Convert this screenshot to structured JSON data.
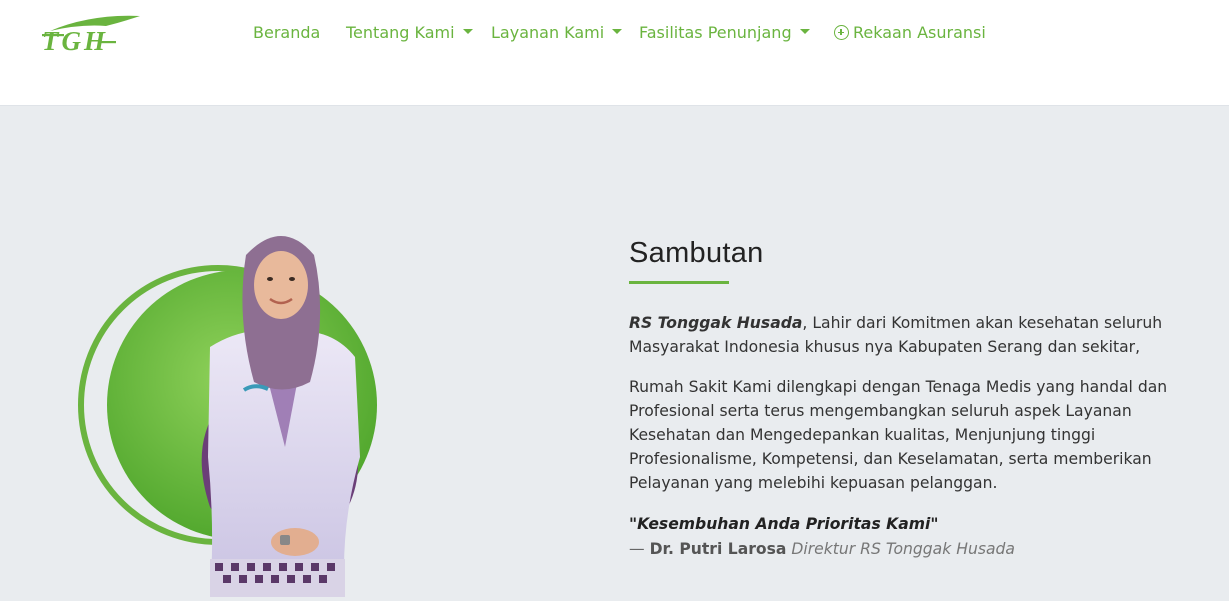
{
  "brand": {
    "logo_text": "TGH",
    "accent_color": "#6ab43f"
  },
  "nav": {
    "items": [
      {
        "label": "Beranda",
        "has_dropdown": false
      },
      {
        "label": "Tentang Kami",
        "has_dropdown": true
      },
      {
        "label": "Layanan Kami",
        "has_dropdown": true
      },
      {
        "label": "Fasilitas Penunjang",
        "has_dropdown": true
      },
      {
        "label": "Rekaan Asuransi",
        "icon": "plus-circle-icon"
      }
    ]
  },
  "sambutan": {
    "title": "Sambutan",
    "p1_strong": "RS Tonggak Husada",
    "p1_rest": ", Lahir dari Komitmen akan kesehatan seluruh Masyarakat Indonesia khusus nya Kabupaten Serang dan sekitar,",
    "p2": "Rumah Sakit Kami dilengkapi dengan Tenaga Medis yang handal dan Profesional serta terus mengembangkan seluruh aspek Layanan Kesehatan dan Mengedepankan kualitas, Menjunjung tinggi Profesionalisme, Kompetensi, dan Keselamatan, serta memberikan Pelayanan yang melebihi kepuasan pelanggan.",
    "quote": "\"Kesembuhan Anda Prioritas Kami\"",
    "author_dash": "— ",
    "author_name": "Dr. Putri Larosa",
    "author_role": "Direktur RS Tonggak Husada"
  }
}
